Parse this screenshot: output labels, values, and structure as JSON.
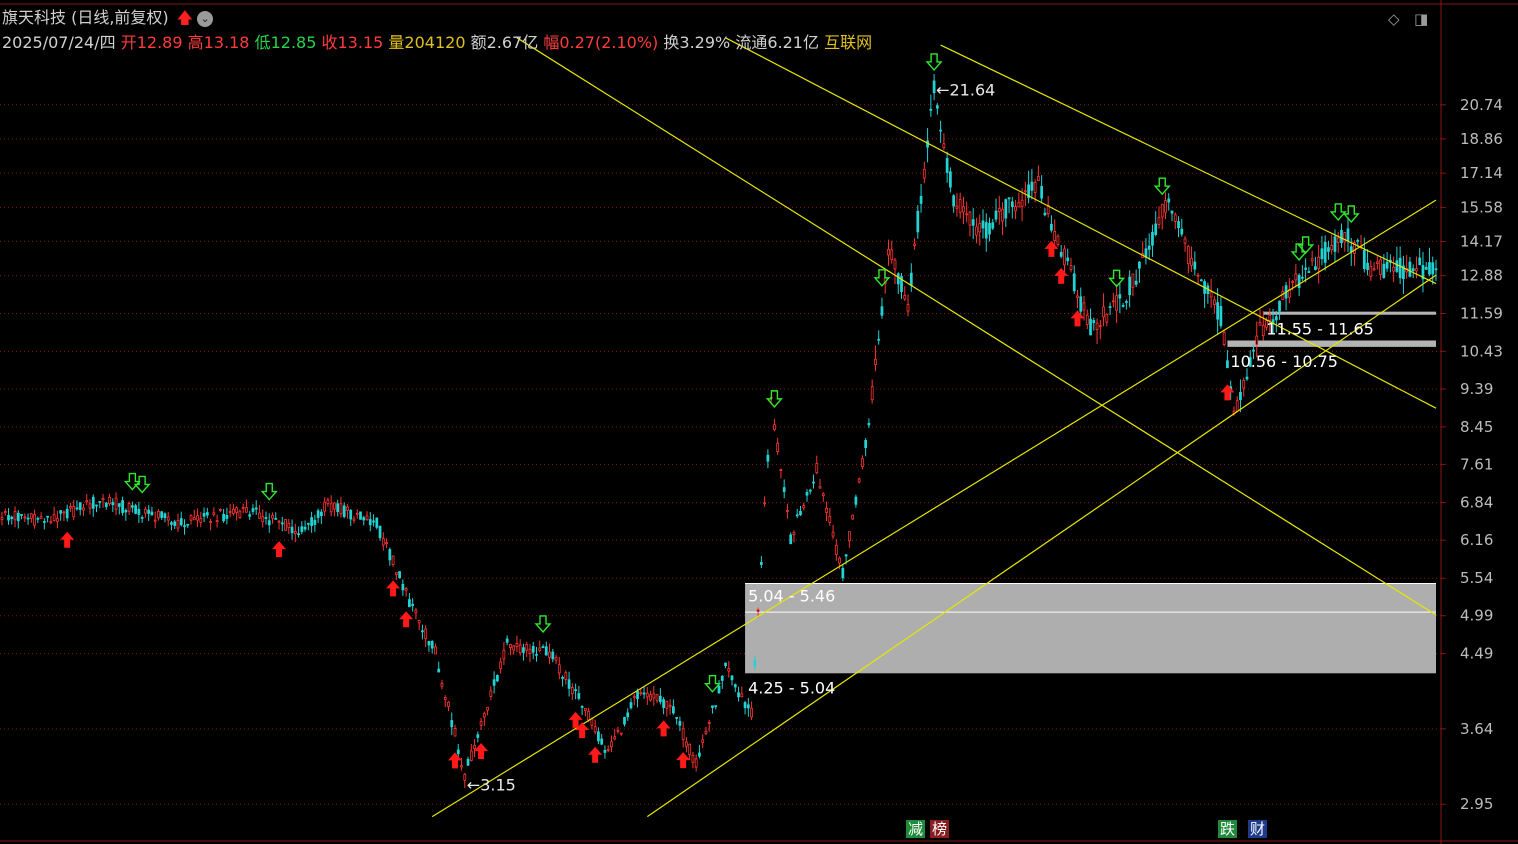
{
  "header": {
    "title": "旗天科技 (日线,前复权)",
    "date": "2025/07/24/四",
    "open_label": "开",
    "open": "12.89",
    "high_label": "高",
    "high": "13.18",
    "low_label": "低",
    "low": "12.85",
    "close_label": "收",
    "close": "13.15",
    "volume_label": "量",
    "volume": "204120",
    "amount_label": "额",
    "amount": "2.67亿",
    "change_label": "幅",
    "change": "0.27(2.10%)",
    "turnover_label": "换",
    "turnover": "3.29%",
    "float_label": "流通",
    "float": "6.21亿",
    "sector": "互联网"
  },
  "toolbar": {
    "diamond_icon": "diamond-icon",
    "panel_icon": "panel-toggle-icon"
  },
  "tags": [
    {
      "text": "减",
      "color": "#1e8a3a"
    },
    {
      "text": "榜",
      "color": "#8a1e1e"
    },
    {
      "text": "跌",
      "color": "#1e8a3a"
    },
    {
      "text": "财",
      "color": "#1e3a8a"
    }
  ],
  "chart_data": {
    "type": "candlestick",
    "y_axis_ticks": [
      20.74,
      18.86,
      17.14,
      15.58,
      14.17,
      12.88,
      11.59,
      10.43,
      9.39,
      8.45,
      7.61,
      6.84,
      6.16,
      5.54,
      4.99,
      4.49,
      3.64,
      2.95
    ],
    "y_range": [
      2.7,
      23.5
    ],
    "log_scale": true,
    "annotations": [
      {
        "text": "←21.64",
        "value": 21.64,
        "kind": "high"
      },
      {
        "text": "←3.15",
        "value": 3.15,
        "kind": "low"
      }
    ],
    "zones": [
      {
        "label": "5.04 - 5.46",
        "low": 5.04,
        "high": 5.46
      },
      {
        "label": "4.25 - 5.04",
        "low": 4.25,
        "high": 5.04
      },
      {
        "label": "11.55 - 11.65",
        "low": 11.55,
        "high": 11.65
      },
      {
        "label": "10.56 - 10.75",
        "low": 10.56,
        "high": 10.75
      }
    ],
    "colors": {
      "up": "#ff3333",
      "down": "#22d3d3",
      "trendline": "#e6e600",
      "grid": "#8a1414",
      "zone": "#bdbdbd"
    },
    "price_path": [
      {
        "i": 0,
        "p": 6.6
      },
      {
        "i": 15,
        "p": 6.5
      },
      {
        "i": 30,
        "p": 6.9
      },
      {
        "i": 55,
        "p": 6.45
      },
      {
        "i": 75,
        "p": 6.7
      },
      {
        "i": 92,
        "p": 6.3
      },
      {
        "i": 100,
        "p": 6.8
      },
      {
        "i": 115,
        "p": 6.45
      },
      {
        "i": 125,
        "p": 5.2
      },
      {
        "i": 133,
        "p": 4.5
      },
      {
        "i": 142,
        "p": 3.2
      },
      {
        "i": 155,
        "p": 4.6
      },
      {
        "i": 168,
        "p": 4.5
      },
      {
        "i": 178,
        "p": 3.9
      },
      {
        "i": 186,
        "p": 3.4
      },
      {
        "i": 195,
        "p": 4.0
      },
      {
        "i": 205,
        "p": 3.9
      },
      {
        "i": 213,
        "p": 3.3
      },
      {
        "i": 222,
        "p": 4.3
      },
      {
        "i": 230,
        "p": 3.8
      },
      {
        "i": 236,
        "p": 9.0
      },
      {
        "i": 242,
        "p": 6.2
      },
      {
        "i": 250,
        "p": 7.5
      },
      {
        "i": 258,
        "p": 5.6
      },
      {
        "i": 266,
        "p": 8.5
      },
      {
        "i": 272,
        "p": 14.0
      },
      {
        "i": 278,
        "p": 12.0
      },
      {
        "i": 286,
        "p": 21.64
      },
      {
        "i": 292,
        "p": 16.0
      },
      {
        "i": 300,
        "p": 14.5
      },
      {
        "i": 308,
        "p": 15.5
      },
      {
        "i": 318,
        "p": 16.5
      },
      {
        "i": 326,
        "p": 13.5
      },
      {
        "i": 334,
        "p": 11.2
      },
      {
        "i": 344,
        "p": 12.0
      },
      {
        "i": 352,
        "p": 14.0
      },
      {
        "i": 358,
        "p": 16.0
      },
      {
        "i": 366,
        "p": 13.0
      },
      {
        "i": 374,
        "p": 11.5
      },
      {
        "i": 378,
        "p": 8.7
      },
      {
        "i": 386,
        "p": 11.0
      },
      {
        "i": 396,
        "p": 12.5
      },
      {
        "i": 404,
        "p": 13.5
      },
      {
        "i": 412,
        "p": 14.5
      },
      {
        "i": 420,
        "p": 13.2
      },
      {
        "i": 430,
        "p": 13.15
      }
    ],
    "signals": [
      {
        "i": 20,
        "dir": "up"
      },
      {
        "i": 40,
        "dir": "down"
      },
      {
        "i": 43,
        "dir": "down"
      },
      {
        "i": 82,
        "dir": "down"
      },
      {
        "i": 85,
        "dir": "up"
      },
      {
        "i": 120,
        "dir": "up"
      },
      {
        "i": 124,
        "dir": "up"
      },
      {
        "i": 139,
        "dir": "up"
      },
      {
        "i": 147,
        "dir": "up"
      },
      {
        "i": 166,
        "dir": "down"
      },
      {
        "i": 176,
        "dir": "up"
      },
      {
        "i": 178,
        "dir": "up"
      },
      {
        "i": 182,
        "dir": "up"
      },
      {
        "i": 203,
        "dir": "up"
      },
      {
        "i": 209,
        "dir": "up"
      },
      {
        "i": 218,
        "dir": "down"
      },
      {
        "i": 237,
        "dir": "down"
      },
      {
        "i": 270,
        "dir": "down"
      },
      {
        "i": 286,
        "dir": "down"
      },
      {
        "i": 322,
        "dir": "up"
      },
      {
        "i": 325,
        "dir": "up"
      },
      {
        "i": 330,
        "dir": "up"
      },
      {
        "i": 342,
        "dir": "down"
      },
      {
        "i": 356,
        "dir": "down"
      },
      {
        "i": 376,
        "dir": "up"
      },
      {
        "i": 398,
        "dir": "down"
      },
      {
        "i": 400,
        "dir": "down"
      },
      {
        "i": 410,
        "dir": "down"
      },
      {
        "i": 414,
        "dir": "down"
      }
    ],
    "trendlines": [
      {
        "from": {
          "i": 132,
          "p": 2.85
        },
        "to": {
          "i": 440,
          "p": 15.9
        }
      },
      {
        "from": {
          "i": 198,
          "p": 2.85
        },
        "to": {
          "i": 440,
          "p": 12.9
        }
      },
      {
        "from": {
          "i": 158,
          "p": 25.0
        },
        "to": {
          "i": 440,
          "p": 5.0
        }
      },
      {
        "from": {
          "i": 222,
          "p": 25.0
        },
        "to": {
          "i": 440,
          "p": 8.9
        }
      },
      {
        "from": {
          "i": 288,
          "p": 24.5
        },
        "to": {
          "i": 440,
          "p": 12.6
        }
      }
    ],
    "n_bars": 441
  }
}
